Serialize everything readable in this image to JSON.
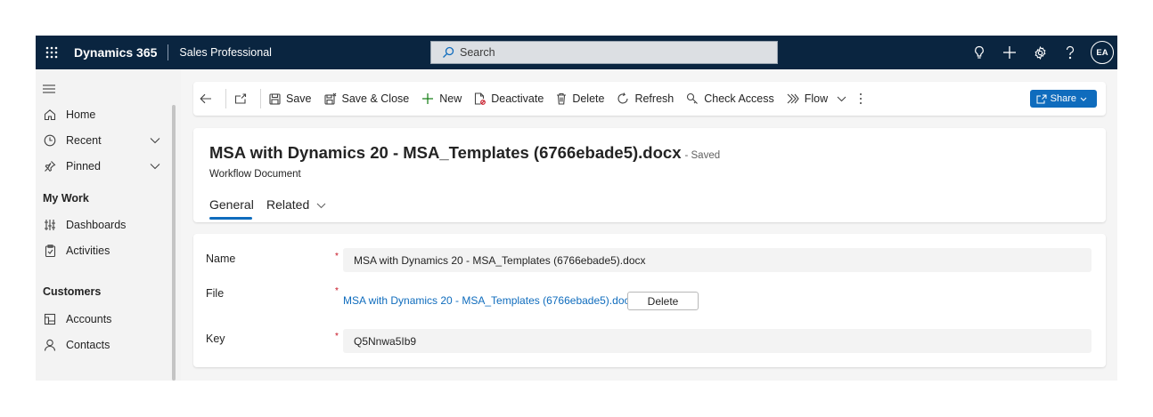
{
  "topbar": {
    "app_name": "Dynamics 365",
    "app_subtitle": "Sales Professional",
    "search_placeholder": "Search",
    "avatar_initials": "EA",
    "icons": [
      "waffle-icon",
      "lightbulb-icon",
      "plus-icon",
      "gear-icon",
      "help-icon"
    ]
  },
  "sidebar": {
    "items_top": [
      {
        "label": "Home",
        "icon": "home-icon"
      },
      {
        "label": "Recent",
        "icon": "clock-icon"
      },
      {
        "label": "Pinned",
        "icon": "pin-icon"
      }
    ],
    "section_my_work": "My Work",
    "items_my_work": [
      {
        "label": "Dashboards",
        "icon": "dashboard-icon"
      },
      {
        "label": "Activities",
        "icon": "clipboard-icon"
      }
    ],
    "section_customers": "Customers",
    "items_customers": [
      {
        "label": "Accounts",
        "icon": "accounts-icon"
      },
      {
        "label": "Contacts",
        "icon": "person-icon"
      }
    ]
  },
  "commandbar": {
    "save": "Save",
    "save_close": "Save & Close",
    "new": "New",
    "deactivate": "Deactivate",
    "delete": "Delete",
    "refresh": "Refresh",
    "check_access": "Check Access",
    "flow": "Flow",
    "share": "Share"
  },
  "record": {
    "title": "MSA with Dynamics 20 - MSA_Templates (6766ebade5).docx",
    "saved_status": "- Saved",
    "entity": "Workflow Document",
    "tabs": [
      "General",
      "Related"
    ]
  },
  "form": {
    "name_label": "Name",
    "name_value": "MSA with Dynamics 20 - MSA_Templates (6766ebade5).docx",
    "file_label": "File",
    "file_link": "MSA with Dynamics 20 - MSA_Templates (6766ebade5).docx",
    "file_delete": "Delete",
    "key_label": "Key",
    "key_value": "Q5Nnwa5Ib9",
    "required_marker": "*"
  },
  "colors": {
    "topbar_bg": "#0a2540",
    "accent": "#0f6cbd",
    "required": "#c50f1f"
  }
}
